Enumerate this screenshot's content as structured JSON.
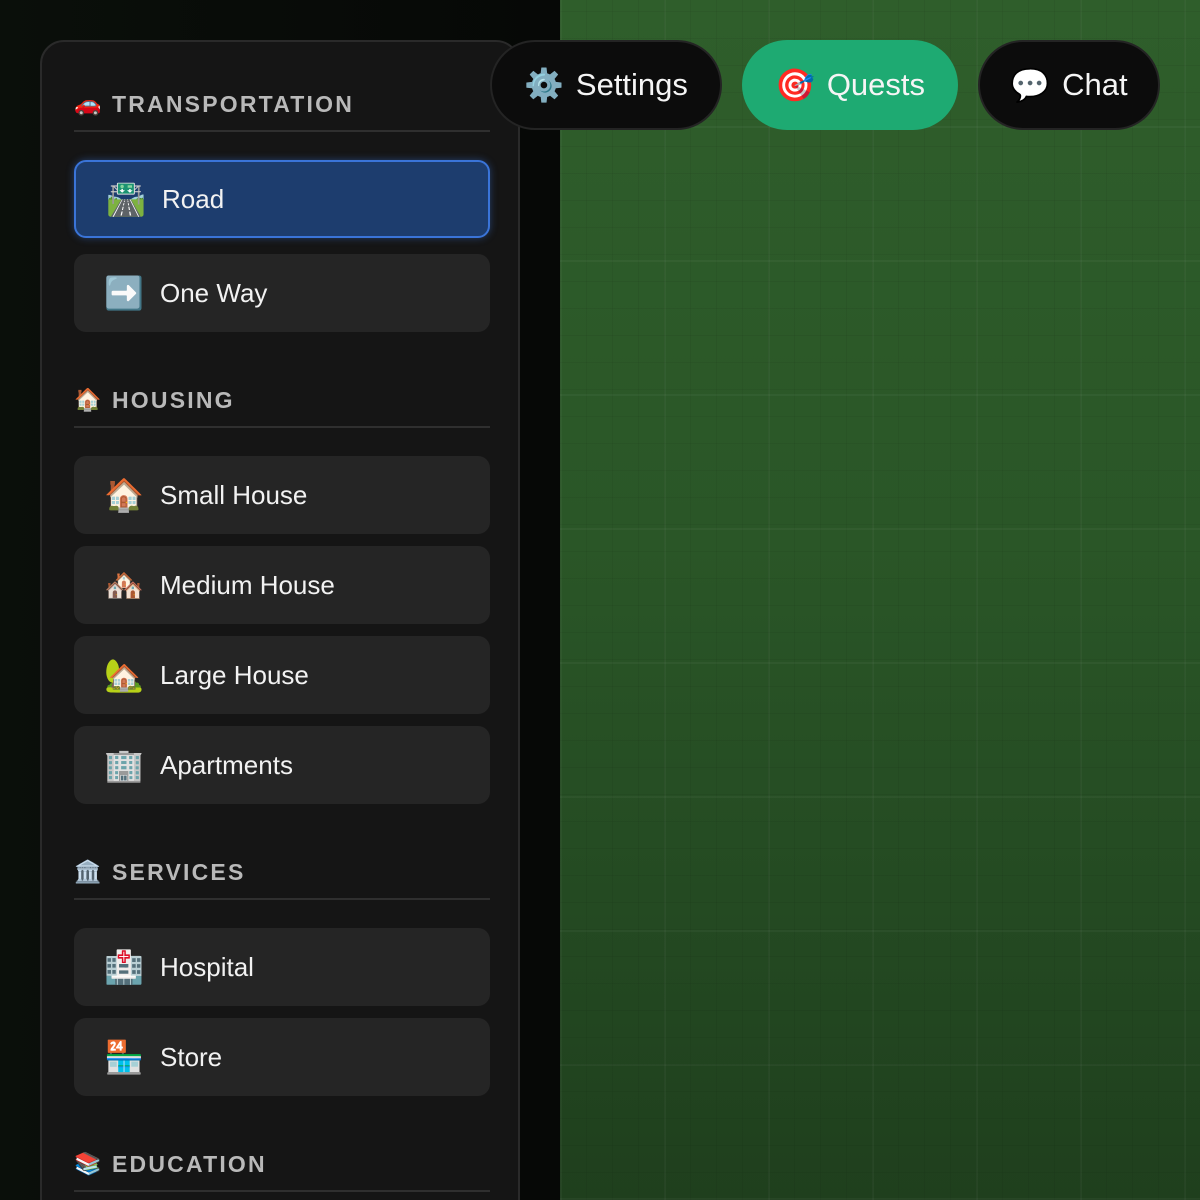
{
  "top_bar": {
    "settings": {
      "label": "Settings",
      "icon": "⚙️"
    },
    "quests": {
      "label": "Quests",
      "icon": "🎯",
      "color": "#1eaa72"
    },
    "chat": {
      "label": "Chat",
      "icon": "💬"
    }
  },
  "sidebar": {
    "sections": [
      {
        "title": "TRANSPORTATION",
        "icon": "🚗",
        "items": [
          {
            "label": "Road",
            "icon": "🛣️",
            "selected": true
          },
          {
            "label": "One Way",
            "icon": "➡️"
          }
        ]
      },
      {
        "title": "HOUSING",
        "icon": "🏠",
        "items": [
          {
            "label": "Small House",
            "icon": "🏠"
          },
          {
            "label": "Medium House",
            "icon": "🏘️"
          },
          {
            "label": "Large House",
            "icon": "🏡"
          },
          {
            "label": "Apartments",
            "icon": "🏢"
          }
        ]
      },
      {
        "title": "SERVICES",
        "icon": "🏛️",
        "items": [
          {
            "label": "Hospital",
            "icon": "🏥"
          },
          {
            "label": "Store",
            "icon": "🏪"
          }
        ]
      },
      {
        "title": "EDUCATION",
        "icon": "📚",
        "items": []
      }
    ]
  },
  "colors": {
    "selected_bg": "#1d3d6e",
    "selected_border": "#3a74d8",
    "map_green": "#2a5627"
  }
}
